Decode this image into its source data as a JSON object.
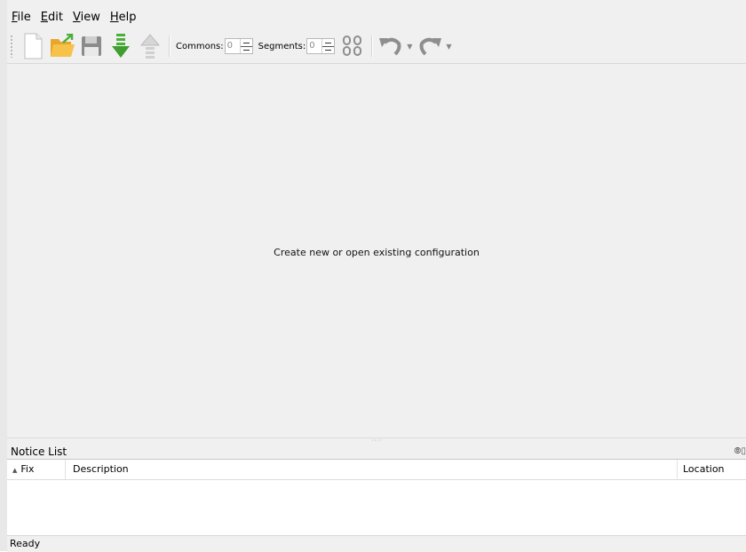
{
  "menubar": {
    "items": [
      {
        "mnemonic": "F",
        "rest": "ile"
      },
      {
        "mnemonic": "E",
        "rest": "dit"
      },
      {
        "mnemonic": "V",
        "rest": "iew"
      },
      {
        "mnemonic": "H",
        "rest": "elp"
      }
    ]
  },
  "toolbar": {
    "buttons": [
      "new-file-icon",
      "open-folder-icon",
      "save-icon",
      "import-arrow-down-icon",
      "export-arrow-up-icon",
      "config-code-icon",
      "undo-icon",
      "redo-icon"
    ],
    "commons_label": "Commons:",
    "commons_value": "0",
    "segments_label": "Segments:",
    "segments_value": "0",
    "accent_green": "#4caf3a",
    "accent_folder": "#f2b63a"
  },
  "main": {
    "message": "Create new or open existing configuration"
  },
  "notice_list": {
    "title": "Notice List",
    "dock_buttons": "⦾▯",
    "columns": {
      "fix": "Fix",
      "description": "Description",
      "location": "Location"
    }
  },
  "status": {
    "text": "Ready"
  }
}
